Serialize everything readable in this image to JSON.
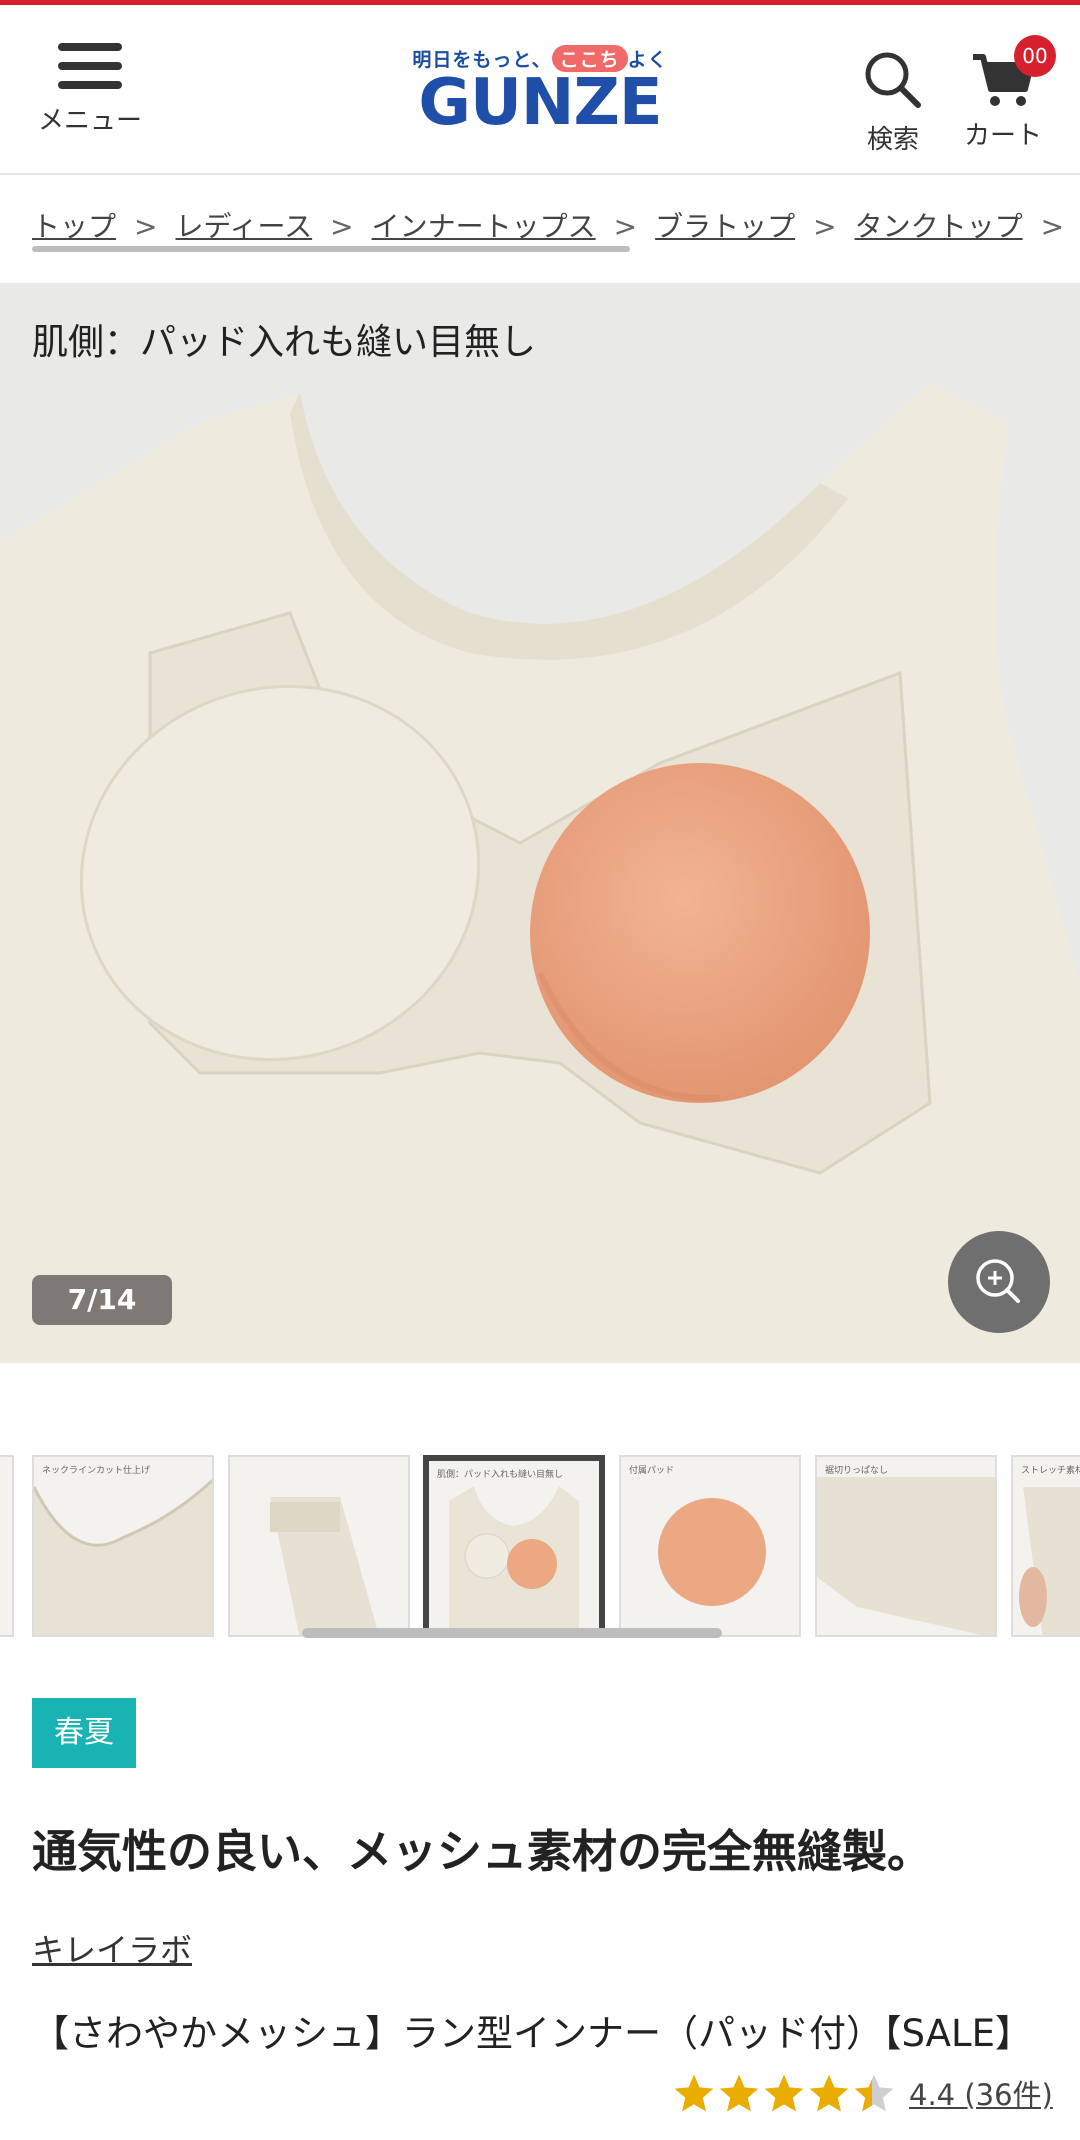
{
  "header": {
    "menu_label": "メニュー",
    "tagline_pre": "明日をもっと、",
    "tagline_pill": "ここち",
    "tagline_post": "よく",
    "brand": "GUNZE",
    "search_label": "検索",
    "cart_label": "カート",
    "cart_count": "00"
  },
  "breadcrumb": {
    "items": [
      "トップ",
      "レディース",
      "インナートップス",
      "ブラトップ",
      "タンクトップ"
    ],
    "separator": ">"
  },
  "gallery": {
    "caption": "肌側：パッド入れも縫い目無し",
    "counter": "7/14",
    "thumb_labels": [
      "ネックラインカット仕上げ",
      "肌側：パッド入れも縫い目無し",
      "付属パッド",
      "裾切りっぱなし",
      "ストレッチ素材"
    ]
  },
  "product": {
    "season": "春夏",
    "headline": "通気性の良い、メッシュ素材の完全無縫製。",
    "brand_link": "キレイラボ",
    "name": "【さわやかメッシュ】ラン型インナー（パッド付）【SALE】",
    "rating_value": 4.4,
    "rating_text": "4.4 (36件)"
  },
  "colors": {
    "accent_red": "#d7202d",
    "brand_blue": "#1f4fa8",
    "season_teal": "#1ab3b3",
    "star": "#e8ad00"
  }
}
